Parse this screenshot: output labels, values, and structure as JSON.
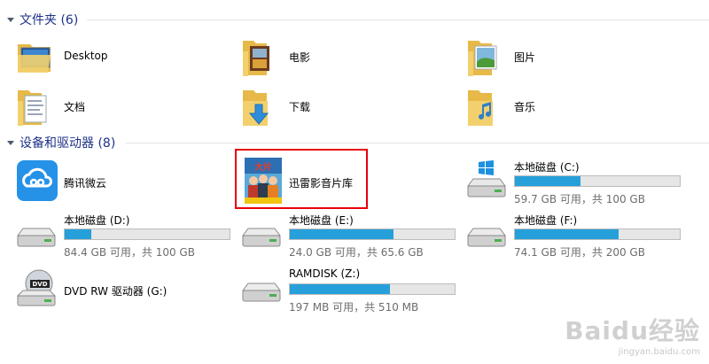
{
  "groups": {
    "folders": {
      "title": "文件夹 (6)"
    },
    "devices": {
      "title": "设备和驱动器 (8)"
    }
  },
  "folders": [
    {
      "label": "Desktop",
      "icon": "desktop-folder-icon"
    },
    {
      "label": "电影",
      "icon": "movies-folder-icon"
    },
    {
      "label": "图片",
      "icon": "pictures-folder-icon"
    },
    {
      "label": "文档",
      "icon": "documents-folder-icon"
    },
    {
      "label": "下载",
      "icon": "downloads-folder-icon"
    },
    {
      "label": "音乐",
      "icon": "music-folder-icon"
    }
  ],
  "devices": [
    {
      "label": "腾讯微云",
      "icon": "weiyun-cloud-icon"
    },
    {
      "label": "迅雷影音片库",
      "icon": "xunlei-library-icon",
      "highlighted": true
    },
    {
      "label": "本地磁盘 (C:)",
      "usage": "59.7 GB 可用，共 100 GB",
      "used_fraction": 0.4,
      "icon": "windows-drive-icon"
    },
    {
      "label": "本地磁盘 (D:)",
      "usage": "84.4 GB 可用，共 100 GB",
      "used_fraction": 0.16,
      "icon": "hard-drive-icon"
    },
    {
      "label": "本地磁盘 (E:)",
      "usage": "24.0 GB 可用，共 65.6 GB",
      "used_fraction": 0.63,
      "icon": "hard-drive-icon"
    },
    {
      "label": "本地磁盘 (F:)",
      "usage": "74.1 GB 可用，共 200 GB",
      "used_fraction": 0.63,
      "icon": "hard-drive-icon"
    },
    {
      "label": "DVD RW 驱动器 (G:)",
      "icon": "dvd-drive-icon"
    },
    {
      "label": "RAMDISK (Z:)",
      "usage": "197 MB 可用，共 510 MB",
      "used_fraction": 0.61,
      "icon": "hard-drive-icon"
    }
  ],
  "watermark": {
    "brand": "Baidu经验",
    "url": "jingyan.baidu.com"
  },
  "colors": {
    "group_title": "#1e3287",
    "bar_fill": "#26a0da",
    "highlight": "#e8000b"
  }
}
